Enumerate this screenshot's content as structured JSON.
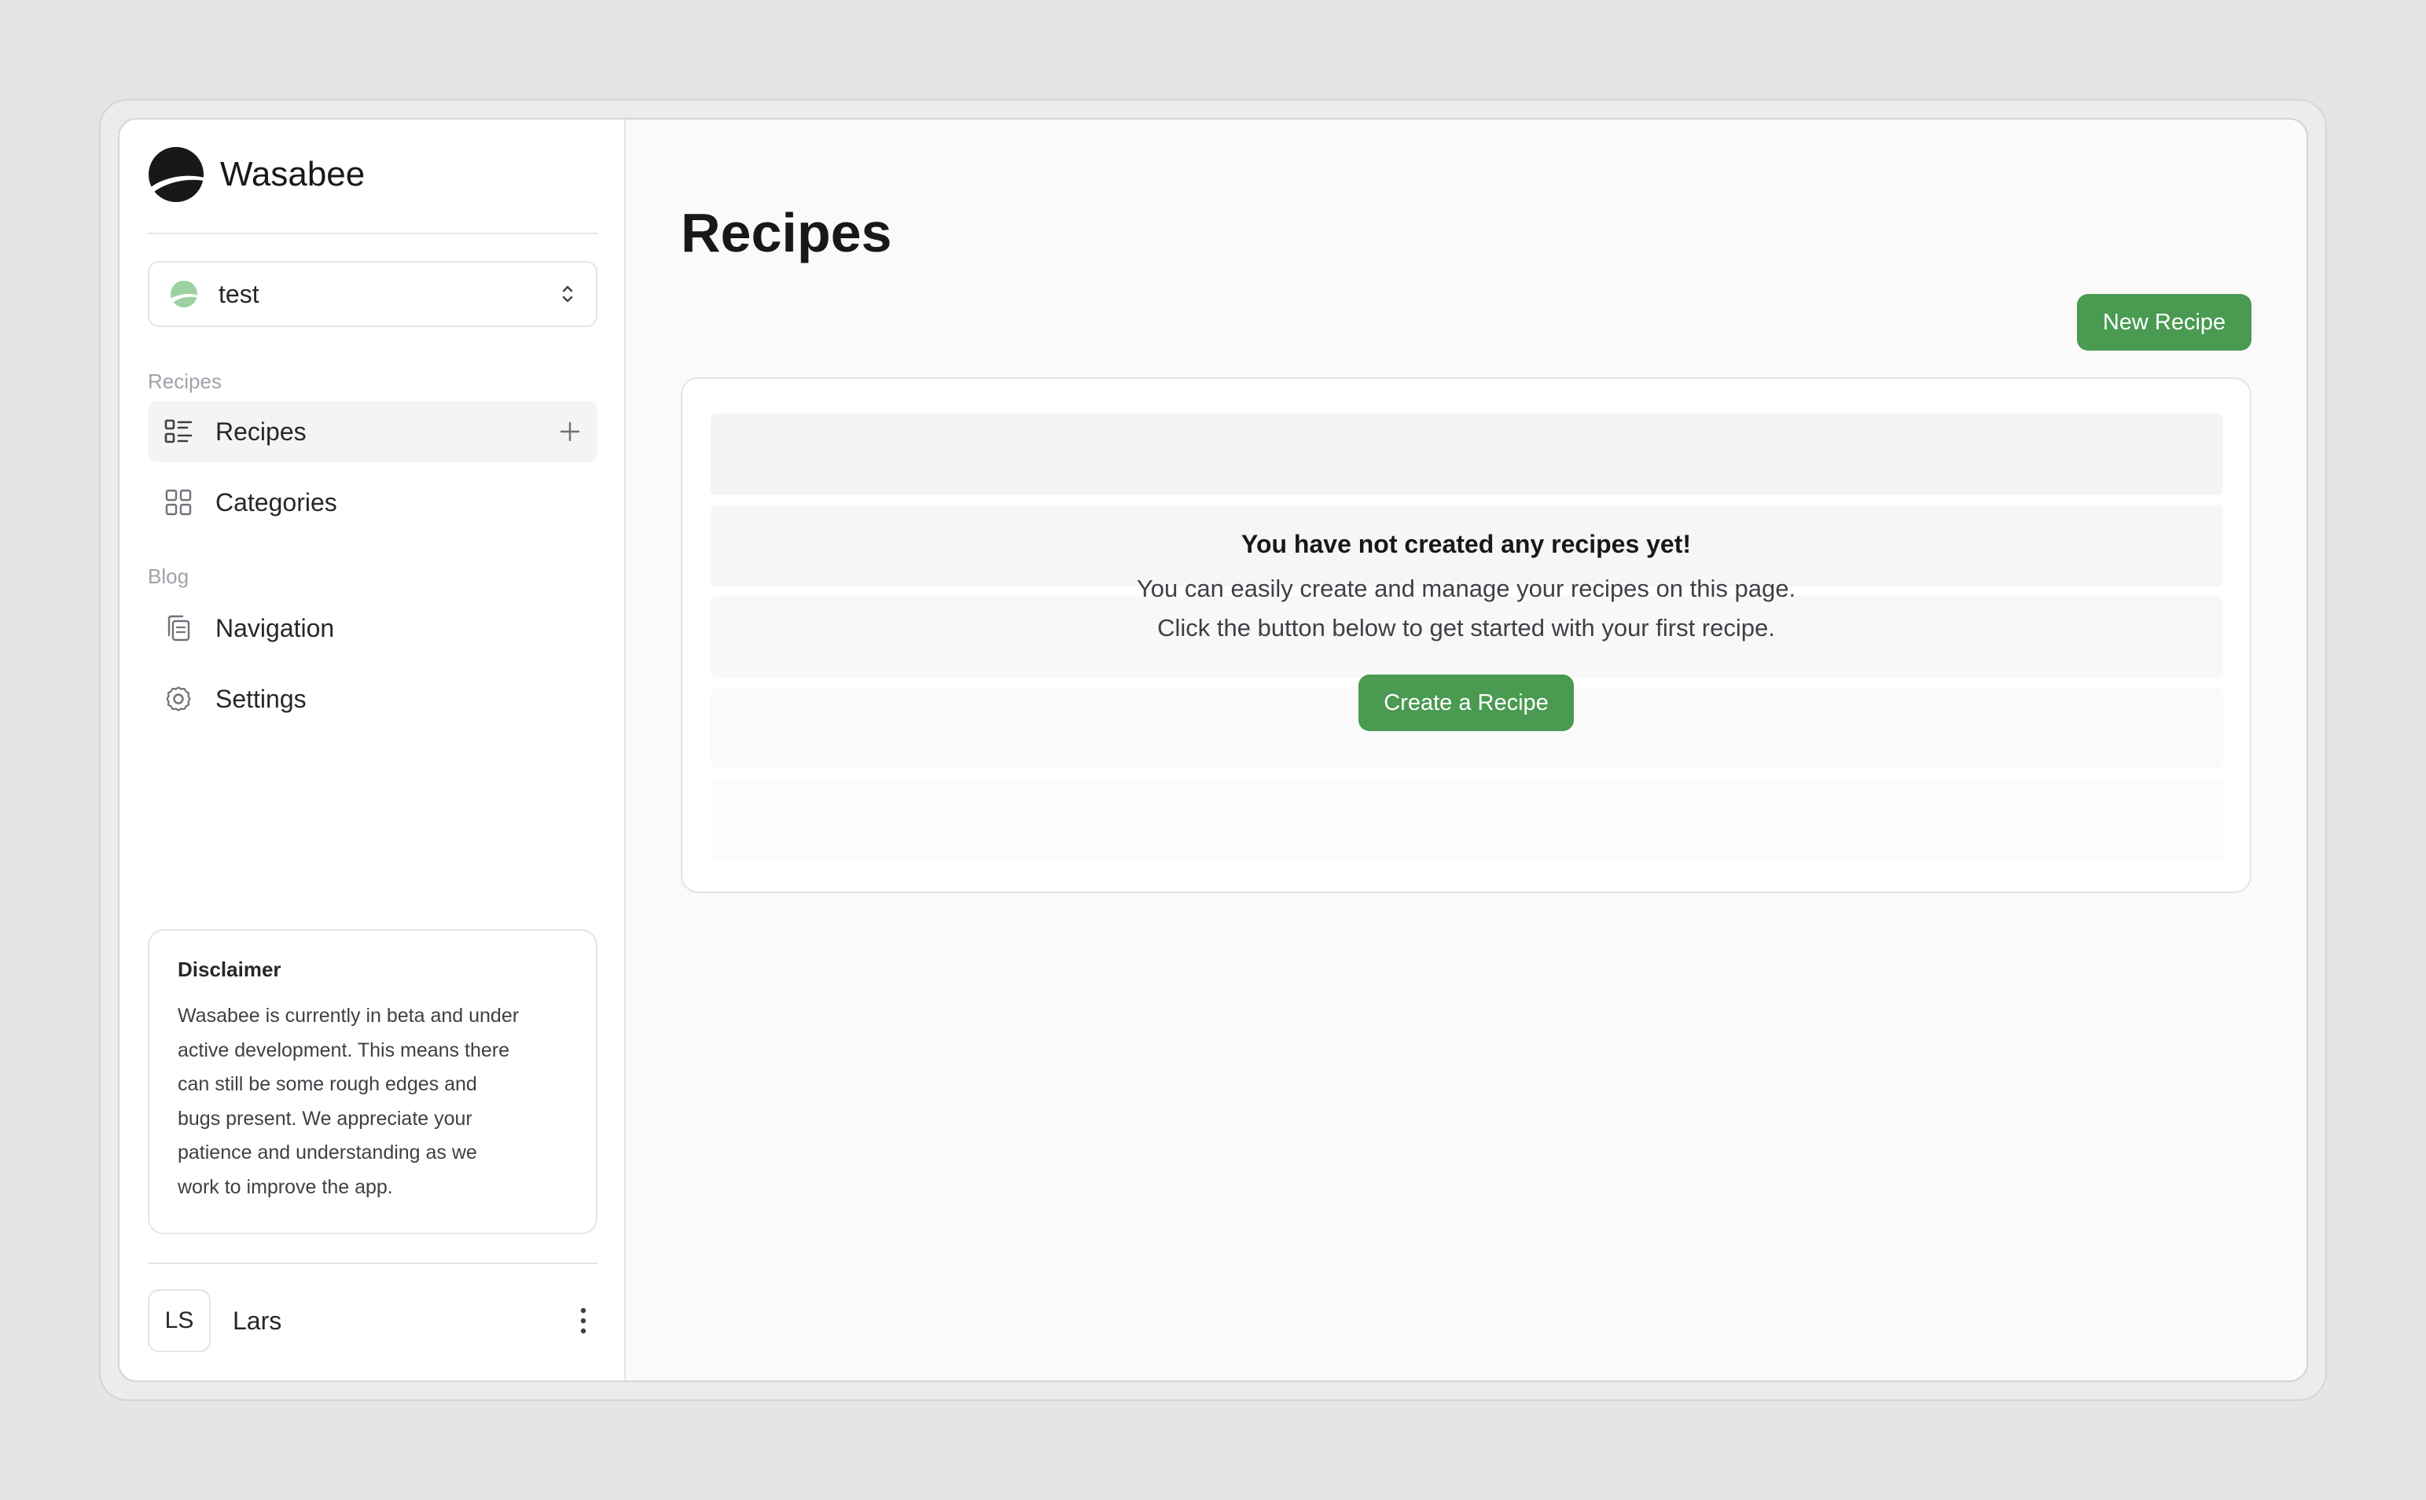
{
  "app": {
    "brand_name": "Wasabee",
    "accent_color": "#4a9a52"
  },
  "sidebar": {
    "workspace": {
      "label": "test",
      "icon": "workspace-leaf-icon"
    },
    "sections": [
      {
        "label": "Recipes",
        "items": [
          {
            "label": "Recipes",
            "icon": "list-icon",
            "active": true,
            "action_icon": "plus-icon"
          },
          {
            "label": "Categories",
            "icon": "grid-icon",
            "active": false
          }
        ]
      },
      {
        "label": "Blog",
        "items": [
          {
            "label": "Navigation",
            "icon": "copy-icon",
            "active": false
          },
          {
            "label": "Settings",
            "icon": "gear-icon",
            "active": false
          }
        ]
      }
    ],
    "disclaimer": {
      "title": "Disclaimer",
      "lines": [
        "Wasabee is currently in beta and under",
        "active development. This means there",
        "can still be some rough edges and",
        "bugs present. We appreciate your",
        "patience and understanding as we",
        "work to improve the app."
      ]
    },
    "user": {
      "initials": "LS",
      "name": "Lars"
    }
  },
  "main": {
    "title": "Recipes",
    "new_button_label": "New Recipe",
    "empty_state": {
      "title": "You have not created any recipes yet!",
      "line1": "You can easily create and manage your recipes on this page.",
      "line2": "Click the button below to get started with your first recipe.",
      "button_label": "Create a Recipe"
    }
  }
}
